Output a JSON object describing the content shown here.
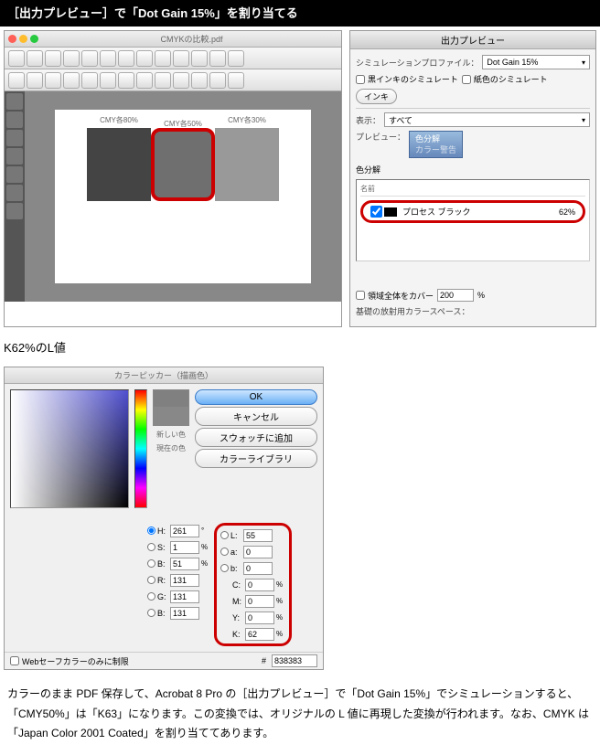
{
  "header": "［出力プレビュー］で「Dot Gain 15%」を割り当てる",
  "acrobat": {
    "filename": "CMYKの比較.pdf",
    "swatches": [
      {
        "label": "CMY各80%"
      },
      {
        "label": "CMY各50%"
      },
      {
        "label": "CMY各30%"
      }
    ]
  },
  "preview": {
    "title": "出力プレビュー",
    "profile_label": "シミュレーションプロファイル：",
    "profile_value": "Dot Gain 15%",
    "sim_ink_label": "黒インキのシミュレート",
    "sim_paper_label": "紙色のシミュレート",
    "ink_btn": "インキ",
    "show_label": "表示：",
    "show_value": "すべて",
    "preview_label": "プレビュー：",
    "preview_opt1": "色分解",
    "preview_opt2": "カラー警告",
    "sep_section": "色分解",
    "sep_head_name": "名前",
    "sep_row_name": "プロセス ブラック",
    "sep_row_pct": "62%",
    "coverage_label": "領域全体をカバー",
    "coverage_value": "200",
    "colorspace_label": "基礎の放射用カラースペース："
  },
  "subhead": "K62%のL値",
  "picker": {
    "title": "カラーピッカー（描画色）",
    "ok": "OK",
    "cancel": "キャンセル",
    "add_swatch": "スウォッチに追加",
    "color_lib": "カラーライブラリ",
    "new_label": "新しい色",
    "current_label": "現在の色",
    "H": "261",
    "S": "1",
    "B": "51",
    "R": "131",
    "G": "131",
    "Bb": "131",
    "L": "55",
    "a": "0",
    "b": "0",
    "C": "0",
    "M": "0",
    "Y": "0",
    "K": "62",
    "hex": "838383",
    "websafe": "Webセーフカラーのみに制限"
  },
  "body": "カラーのまま PDF 保存して、Acrobat 8 Pro の［出力プレビュー］で「Dot Gain 15%」でシミュレーションすると、「CMY50%」は「K63」になります。この変換では、オリジナルの L 値に再現した変換が行われます。なお、CMYK は「Japan Color 2001 Coated」を割り当ててあります。"
}
